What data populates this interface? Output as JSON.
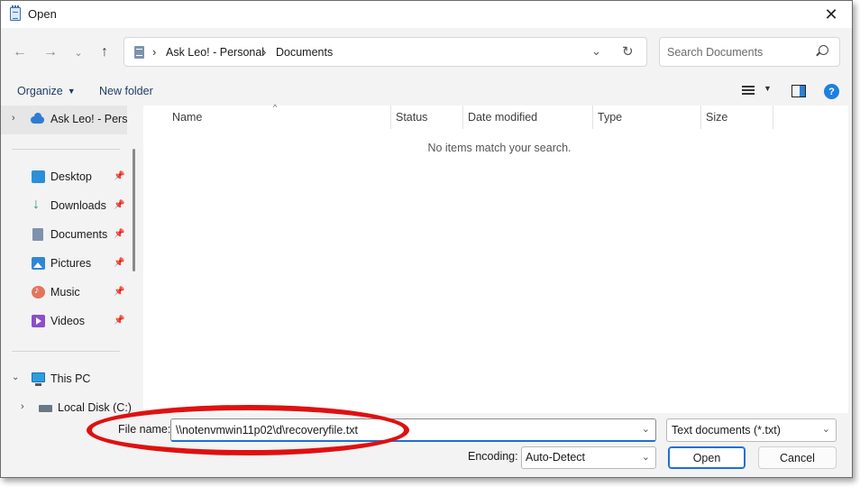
{
  "window": {
    "title": "Open"
  },
  "address": {
    "crumbs": [
      "Ask Leo! - Personal",
      "Documents"
    ]
  },
  "search": {
    "placeholder": "Search Documents"
  },
  "toolbar": {
    "organize_label": "Organize",
    "new_folder_label": "New folder",
    "help_label": "?"
  },
  "nav": {
    "top_item": "Ask Leo! - Perso",
    "quick_access": [
      {
        "label": "Desktop",
        "icon": "desktop-icon"
      },
      {
        "label": "Downloads",
        "icon": "downloads-icon"
      },
      {
        "label": "Documents",
        "icon": "documents-icon"
      },
      {
        "label": "Pictures",
        "icon": "pictures-icon"
      },
      {
        "label": "Music",
        "icon": "music-icon"
      },
      {
        "label": "Videos",
        "icon": "videos-icon"
      }
    ],
    "this_pc": "This PC",
    "local_disk": "Local Disk (C:)"
  },
  "columns": [
    "Name",
    "Status",
    "Date modified",
    "Type",
    "Size"
  ],
  "empty_message": "No items match your search.",
  "bottom": {
    "file_name_label": "File name:",
    "file_name_value": "\\\\notenvmwin11p02\\d\\recoveryfile.txt",
    "filter_value": "Text documents (*.txt)",
    "encoding_label": "Encoding:",
    "encoding_value": "Auto-Detect",
    "open_label": "Open",
    "cancel_label": "Cancel"
  },
  "colors": {
    "accent": "#1f6fd1",
    "annotation": "#e01010"
  }
}
